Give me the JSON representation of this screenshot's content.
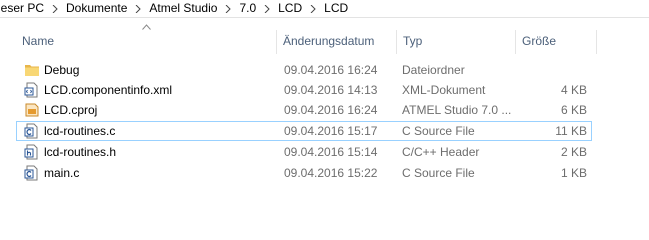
{
  "breadcrumb": {
    "items": [
      "ieser PC",
      "Dokumente",
      "Atmel Studio",
      "7.0",
      "LCD",
      "LCD"
    ]
  },
  "columns": {
    "name": "Name",
    "date": "Änderungsdatum",
    "type": "Typ",
    "size": "Größe"
  },
  "files": [
    {
      "name": "Debug",
      "date": "09.04.2016 16:24",
      "type": "Dateiordner",
      "size": "",
      "icon": "folder-icon"
    },
    {
      "name": "LCD.componentinfo.xml",
      "date": "09.04.2016 14:13",
      "type": "XML-Dokument",
      "size": "4 KB",
      "icon": "xml-file-icon"
    },
    {
      "name": "LCD.cproj",
      "date": "09.04.2016 16:24",
      "type": "ATMEL Studio 7.0 ...",
      "size": "6 KB",
      "icon": "atmel-project-icon"
    },
    {
      "name": "lcd-routines.c",
      "date": "09.04.2016 15:17",
      "type": "C Source File",
      "size": "11 KB",
      "icon": "c-source-file-icon"
    },
    {
      "name": "lcd-routines.h",
      "date": "09.04.2016 15:14",
      "type": "C/C++ Header",
      "size": "2 KB",
      "icon": "header-file-icon"
    },
    {
      "name": "main.c",
      "date": "09.04.2016 15:22",
      "type": "C Source File",
      "size": "1 KB",
      "icon": "c-source-file-icon"
    }
  ],
  "selection": {
    "selected_row": 3,
    "accent": "#99d1ff"
  }
}
